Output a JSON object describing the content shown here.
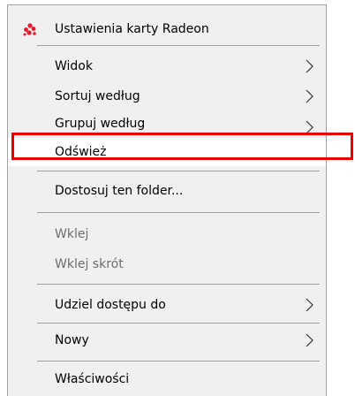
{
  "menu": {
    "radeon_label": "Ustawienia karty Radeon",
    "view_label": "Widok",
    "sort_label": "Sortuj według",
    "group_label": "Grupuj według",
    "refresh_label": "Odśwież",
    "customize_label": "Dostosuj ten folder...",
    "paste_label": "Wklej",
    "paste_shortcut_label": "Wklej skrót",
    "share_label": "Udziel dostępu do",
    "new_label": "Nowy",
    "properties_label": "Właściwości"
  },
  "icons": {
    "radeon": "amd-radeon-icon",
    "submenu": "chevron-right-icon"
  },
  "colors": {
    "menu_background": "#f0f0f0",
    "highlight_background": "#ffffff",
    "annotation_box": "#e60000",
    "radeon_icon": "#e8192c",
    "disabled_text": "#6d6d6d"
  }
}
